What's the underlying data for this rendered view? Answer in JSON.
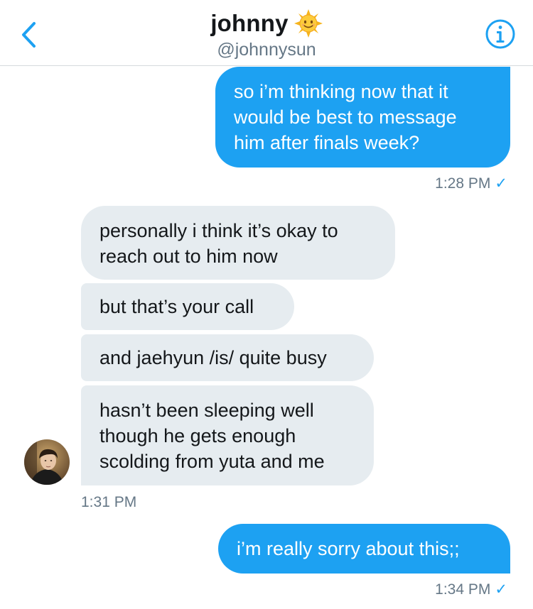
{
  "header": {
    "title": "johnny",
    "title_emoji": "sun-face-emoji",
    "handle": "@johnnysun",
    "back_icon": "chevron-left-icon",
    "info_icon": "info-icon",
    "accent_color": "#1da1f2"
  },
  "messages": {
    "m1": {
      "from": "me",
      "lines": [
        "so i’m thinking now that it",
        "would be best to message",
        "him after finals week?"
      ]
    },
    "ts1": {
      "time": "1:28 PM",
      "check": "✓"
    },
    "m2": {
      "from": "johnny",
      "lines": [
        "personally i think it’s okay to",
        "reach out to him now"
      ]
    },
    "m3": {
      "from": "johnny",
      "lines": [
        "but that’s your call"
      ]
    },
    "m4": {
      "from": "johnny",
      "lines": [
        "and jaehyun /is/ quite busy"
      ]
    },
    "m5": {
      "from": "johnny",
      "lines": [
        "hasn’t been sleeping well",
        "though he gets enough",
        "scolding from yuta and me"
      ]
    },
    "ts2": {
      "time": "1:31 PM"
    },
    "m6": {
      "from": "me",
      "lines": [
        "i’m really sorry about this;;"
      ]
    },
    "ts3": {
      "time": "1:34 PM",
      "check": "✓"
    }
  },
  "colors": {
    "sent_bubble": "#1da1f2",
    "received_bubble": "#e6ecf0",
    "timestamp": "#657786"
  }
}
